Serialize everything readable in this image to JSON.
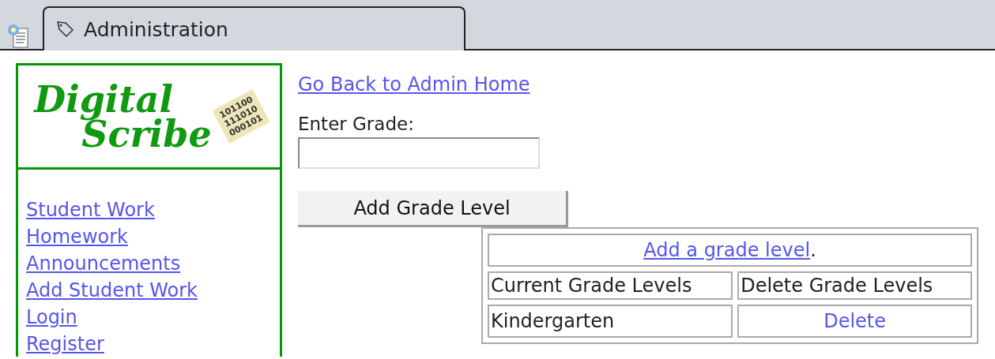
{
  "tabs": [
    {
      "label": "Administration",
      "selected": true
    }
  ],
  "logo": {
    "line_1": "Digital",
    "line_2": "Scribe",
    "binary": [
      "101100",
      "111010",
      "000101"
    ]
  },
  "nav_links": [
    "Student Work",
    "Homework",
    "Announcements",
    "Add Student Work",
    "Login",
    "Register"
  ],
  "back_link": "Go Back to Admin Home",
  "grade_field": {
    "label": "Enter Grade:"
  },
  "add_button": "Add Grade Level",
  "table": {
    "caption_link": "Add a grade level",
    "caption_tail": ".",
    "columns": [
      "Current Grade Levels",
      "Delete Grade Levels"
    ],
    "rows": [
      {
        "grade": "Kindergarten",
        "action": "Delete"
      }
    ]
  }
}
